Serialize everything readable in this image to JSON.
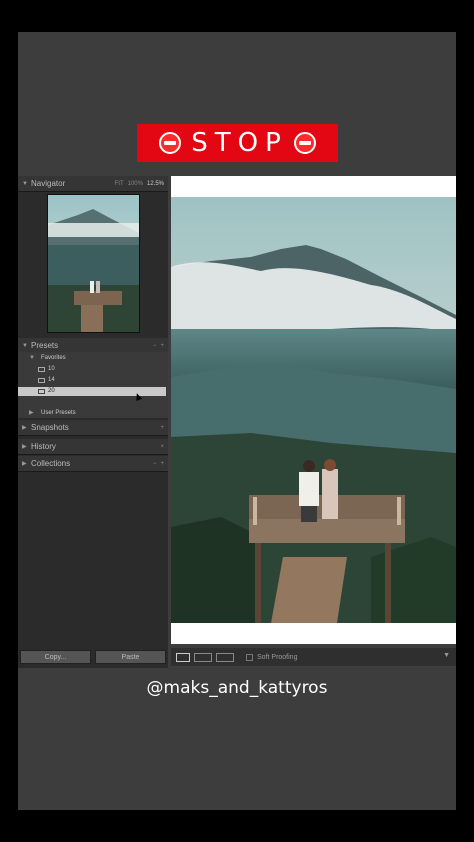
{
  "overlay": {
    "stop_text": "STOP",
    "handle": "@maks_and_kattyros",
    "banner_color": "#e30613"
  },
  "navigator": {
    "title": "Navigator",
    "zoom_options": [
      "FIT",
      "100%",
      "12.5%"
    ]
  },
  "presets": {
    "title": "Presets",
    "group_favorites": "Favorites",
    "items": [
      "10",
      "14",
      "20"
    ],
    "selected": "20",
    "group_user": "User Presets"
  },
  "panels": {
    "snapshots": "Snapshots",
    "history": "History",
    "collections": "Collections",
    "plus": "+",
    "minus": "−",
    "close": "×"
  },
  "buttons": {
    "copy": "Copy...",
    "paste": "Paste"
  },
  "toolbar": {
    "soft_proofing": "Soft Proofing"
  }
}
